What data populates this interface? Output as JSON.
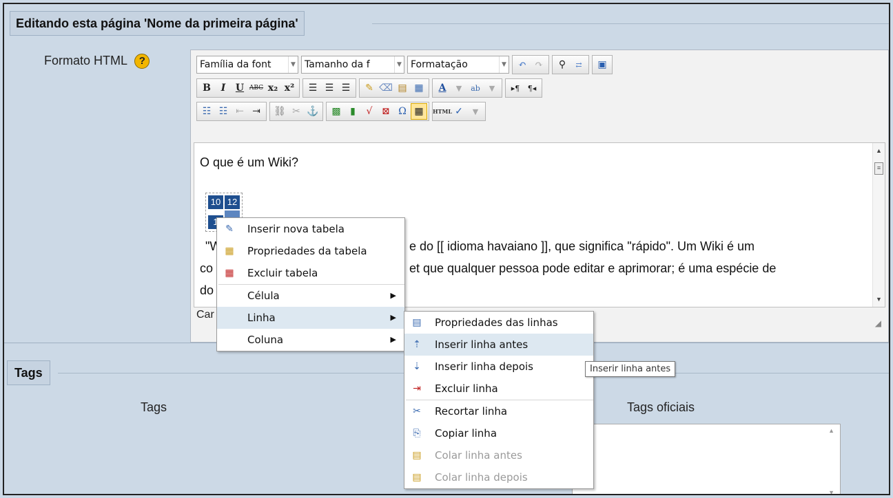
{
  "fieldset_editing": {
    "legend": "Editando esta página 'Nome da primeira página'"
  },
  "format_label": "Formato HTML",
  "help_icon_text": "?",
  "toolbar": {
    "font_family": "Família da font",
    "font_size": "Tamanho da f",
    "format": "Formatação",
    "row1_icons": [
      "undo-icon",
      "redo-icon",
      "find-icon",
      "replace-icon",
      "fullscreen-icon"
    ],
    "row2_buttons": [
      "B",
      "I",
      "U",
      "ABC",
      "X₂",
      "X²"
    ],
    "row2_icons": [
      "align-left-icon",
      "align-center-icon",
      "align-right-icon",
      "cleanup-icon",
      "eraser-icon",
      "paste-text-icon",
      "paste-word-icon",
      "text-color-icon",
      "highlight-icon",
      "ltr-icon",
      "rtl-icon"
    ],
    "row3_icons": [
      "bullet-list-icon",
      "numbered-list-icon",
      "outdent-icon",
      "indent-icon",
      "link-icon",
      "unlink-icon",
      "anchor-icon",
      "image-icon",
      "media-icon",
      "equation-icon",
      "nonbreaking-icon",
      "omega-icon",
      "table-icon",
      "html-icon",
      "spellcheck-icon"
    ],
    "bold": "B",
    "italic": "I",
    "underline": "U",
    "strike": "ABC",
    "sub": "x₂",
    "sup": "x²",
    "omega": "Ω",
    "html": "HTML"
  },
  "content": {
    "heading": "O que é um Wiki?",
    "table_cells": [
      "10",
      "12",
      "1",
      ""
    ],
    "para_line1": "\"W",
    "para_line1_tail": "e do [[ idioma havaiano ]], que significa \"rápido\". Um Wiki é um",
    "para_line2": "co",
    "para_line2_tail": "et que qualquer pessoa pode editar e aprimorar; é uma espécie de",
    "para_line3": "do",
    "status": "Car"
  },
  "context_menu": {
    "items": [
      {
        "label": "Inserir nova tabela",
        "icon": "new-table-icon"
      },
      {
        "label": "Propriedades da tabela",
        "icon": "table-props-icon"
      },
      {
        "label": "Excluir tabela",
        "icon": "delete-table-icon"
      },
      {
        "label": "Célula"
      },
      {
        "label": "Linha"
      },
      {
        "label": "Coluna"
      }
    ]
  },
  "row_submenu": {
    "items": [
      {
        "label": "Propriedades das linhas",
        "icon": "row-props-icon"
      },
      {
        "label": "Inserir linha antes",
        "icon": "insert-row-before-icon"
      },
      {
        "label": "Inserir linha depois",
        "icon": "insert-row-after-icon"
      },
      {
        "label": "Excluir linha",
        "icon": "delete-row-icon"
      },
      {
        "label": "Recortar linha",
        "icon": "cut-icon"
      },
      {
        "label": "Copiar linha",
        "icon": "copy-icon"
      },
      {
        "label": "Colar linha antes",
        "icon": "paste-before-icon"
      },
      {
        "label": "Colar linha depois",
        "icon": "paste-after-icon"
      }
    ]
  },
  "tooltip": "Inserir linha antes",
  "tags_fieldset": {
    "legend": "Tags",
    "tags_label": "Tags",
    "official_label": "Tags oficiais"
  }
}
